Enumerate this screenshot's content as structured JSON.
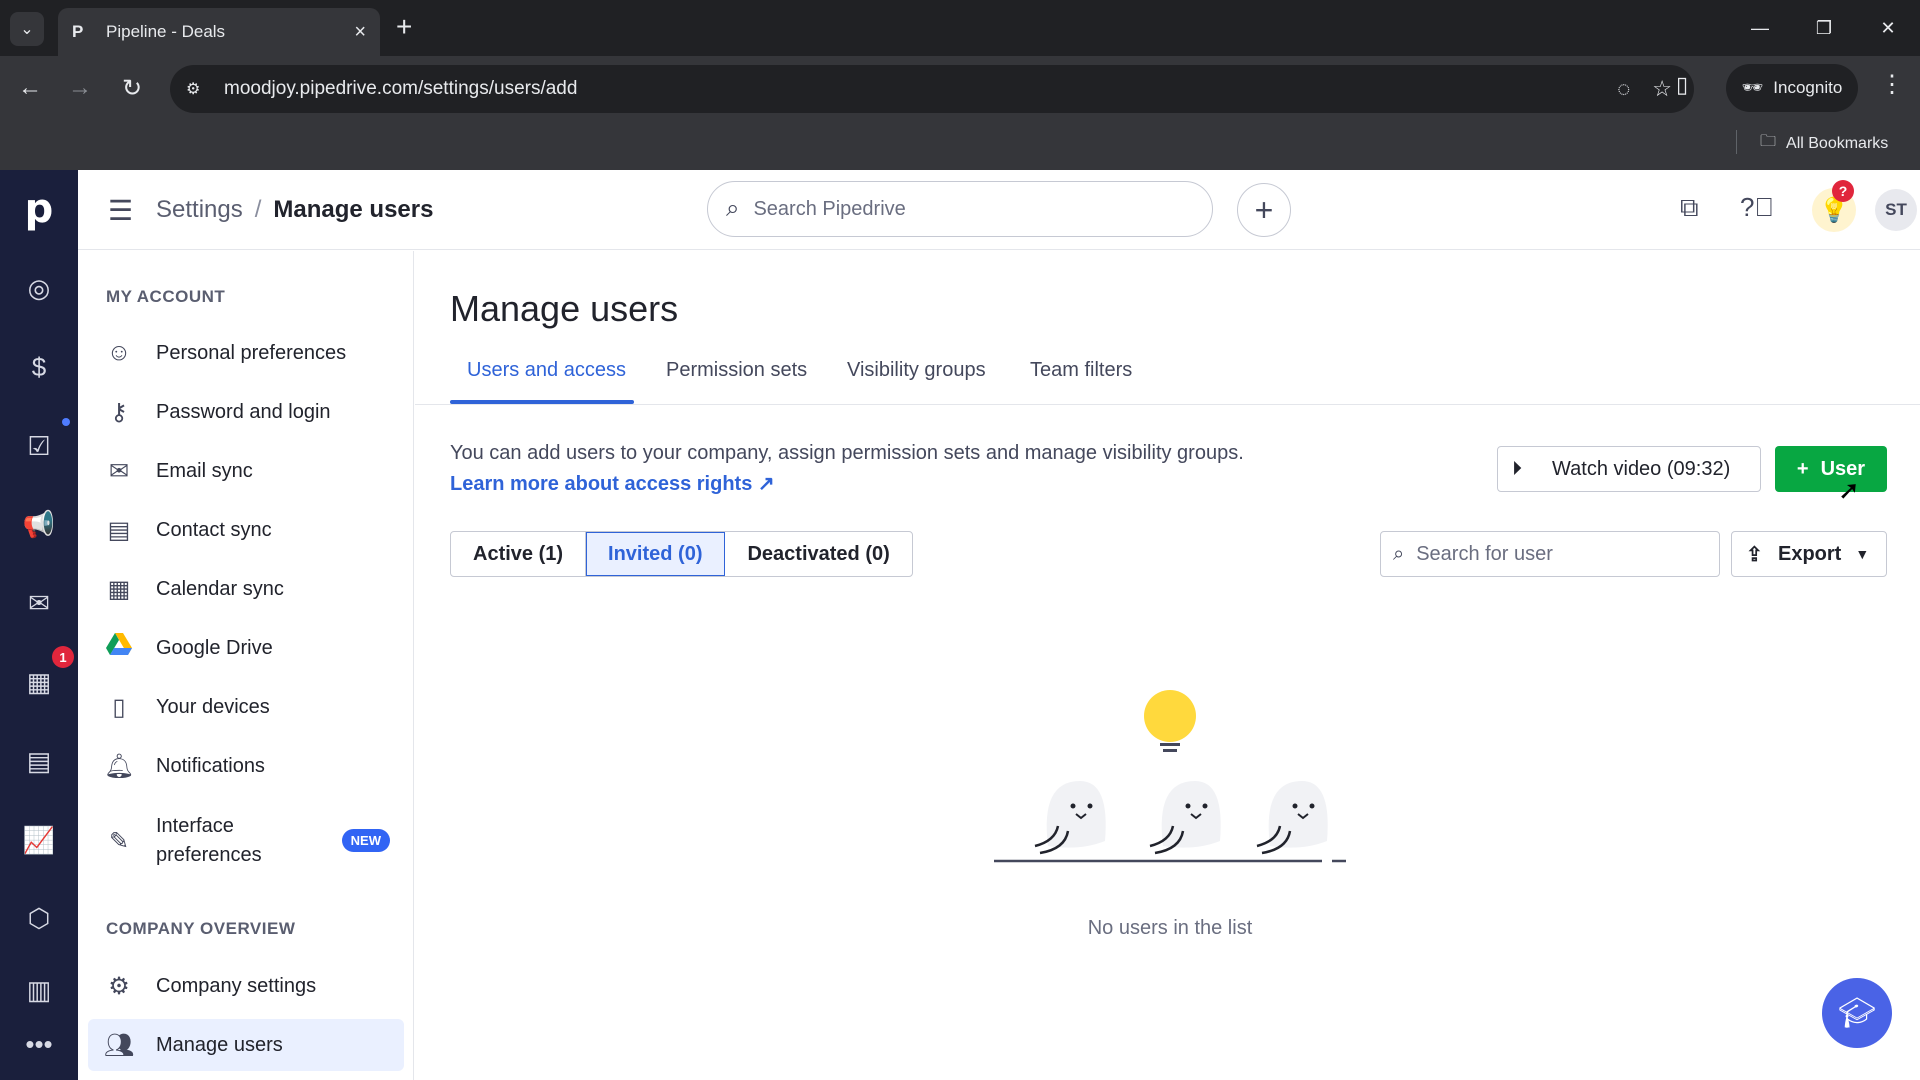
{
  "browser": {
    "tab_title": "Pipeline - Deals",
    "tab_favicon": "P",
    "url": "moodjoy.pipedrive.com/settings/users/add",
    "incognito_label": "Incognito",
    "bookmarks_label": "All Bookmarks"
  },
  "rail": {
    "logo": "p",
    "badge_count": "1"
  },
  "header": {
    "breadcrumb_root": "Settings",
    "breadcrumb_sep": "/",
    "breadcrumb_current": "Manage users",
    "search_placeholder": "Search Pipedrive",
    "bulb_badge": "?",
    "avatar_initials": "ST"
  },
  "sidebar": {
    "my_account_heading": "MY ACCOUNT",
    "company_heading": "COMPANY OVERVIEW",
    "items": [
      {
        "label": "Personal preferences",
        "icon": "smiley-icon"
      },
      {
        "label": "Password and login",
        "icon": "key-icon"
      },
      {
        "label": "Email sync",
        "icon": "envelope-icon"
      },
      {
        "label": "Contact sync",
        "icon": "contact-card-icon"
      },
      {
        "label": "Calendar sync",
        "icon": "calendar-icon"
      },
      {
        "label": "Google Drive",
        "icon": "google-drive-icon"
      },
      {
        "label": "Your devices",
        "icon": "phone-icon"
      },
      {
        "label": "Notifications",
        "icon": "bell-icon"
      },
      {
        "label": "Interface preferences",
        "icon": "interface-icon",
        "badge": "NEW"
      }
    ],
    "company_items": [
      {
        "label": "Company settings",
        "icon": "gear-icon"
      },
      {
        "label": "Manage users",
        "icon": "users-icon",
        "active": true
      }
    ]
  },
  "main": {
    "title": "Manage users",
    "tabs": [
      "Users and access",
      "Permission sets",
      "Visibility groups",
      "Team filters"
    ],
    "active_tab": "Users and access",
    "description": "You can add users to your company, assign permission sets and manage visibility groups.",
    "learn_more": "Learn more about access rights ↗",
    "watch_video": "Watch video (09:32)",
    "add_user": "User",
    "filters": [
      "Active (1)",
      "Invited (0)",
      "Deactivated (0)"
    ],
    "active_filter": "Invited (0)",
    "user_search_placeholder": "Search for user",
    "export_label": "Export",
    "empty_text": "No users in the list"
  },
  "colors": {
    "rail_bg": "#1a1f3c",
    "accent_blue": "#2f63d8",
    "primary_green": "#08a742",
    "badge_red": "#e0263c"
  }
}
